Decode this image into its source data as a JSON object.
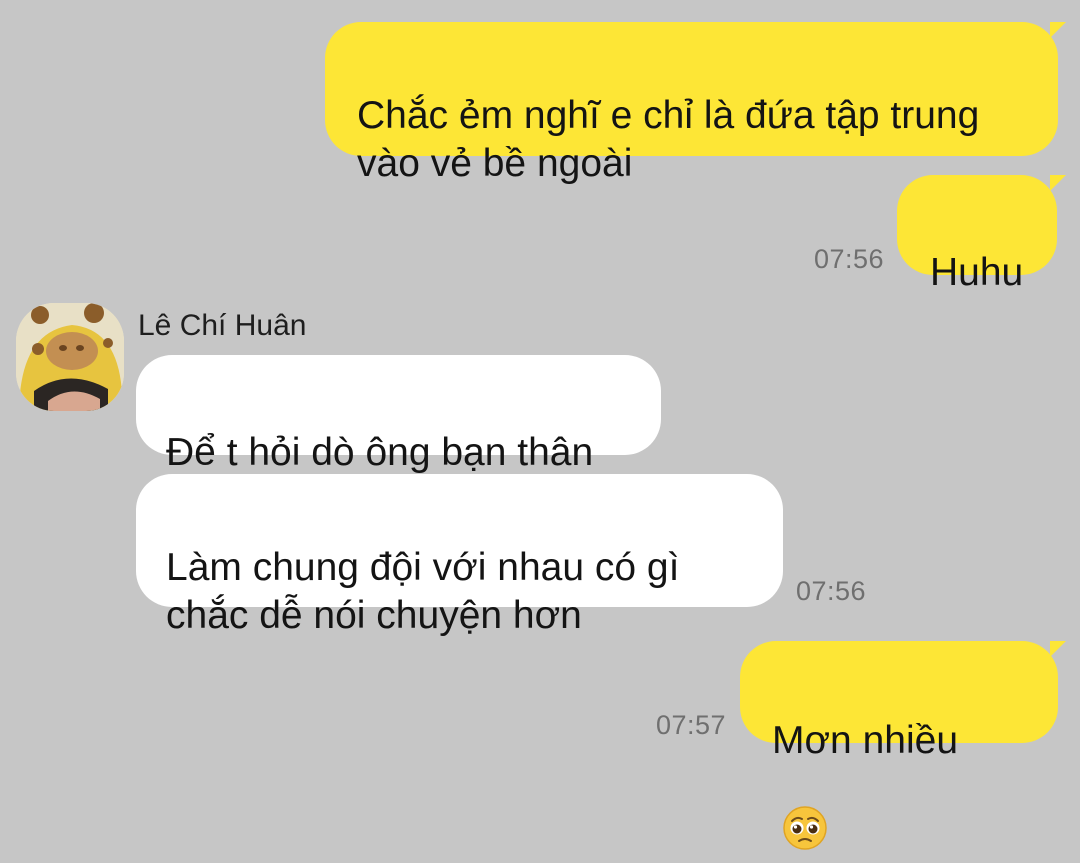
{
  "messages": [
    {
      "id": "m1",
      "side": "me",
      "text": "Chắc ẻm nghĩ e chỉ là đứa tập trung\nvào vẻ bề ngoài"
    },
    {
      "id": "m2",
      "side": "me",
      "text": "Huhu",
      "time": "07:56"
    },
    {
      "id": "m3",
      "side": "them",
      "sender": "Lê Chí Huân",
      "text": "Để t hỏi dò ông bạn thân"
    },
    {
      "id": "m4",
      "side": "them",
      "text": "Làm chung đội với nhau có gì\nchắc dễ nói chuyện hơn",
      "time": "07:56"
    },
    {
      "id": "m5",
      "side": "me",
      "text": "Mơn nhiều",
      "emoji": "pleading-face-icon",
      "time": "07:57"
    }
  ],
  "colors": {
    "background": "#c6c6c6",
    "outgoing_bubble": "#fde636",
    "incoming_bubble": "#ffffff",
    "timestamp": "#6f6f6f"
  }
}
